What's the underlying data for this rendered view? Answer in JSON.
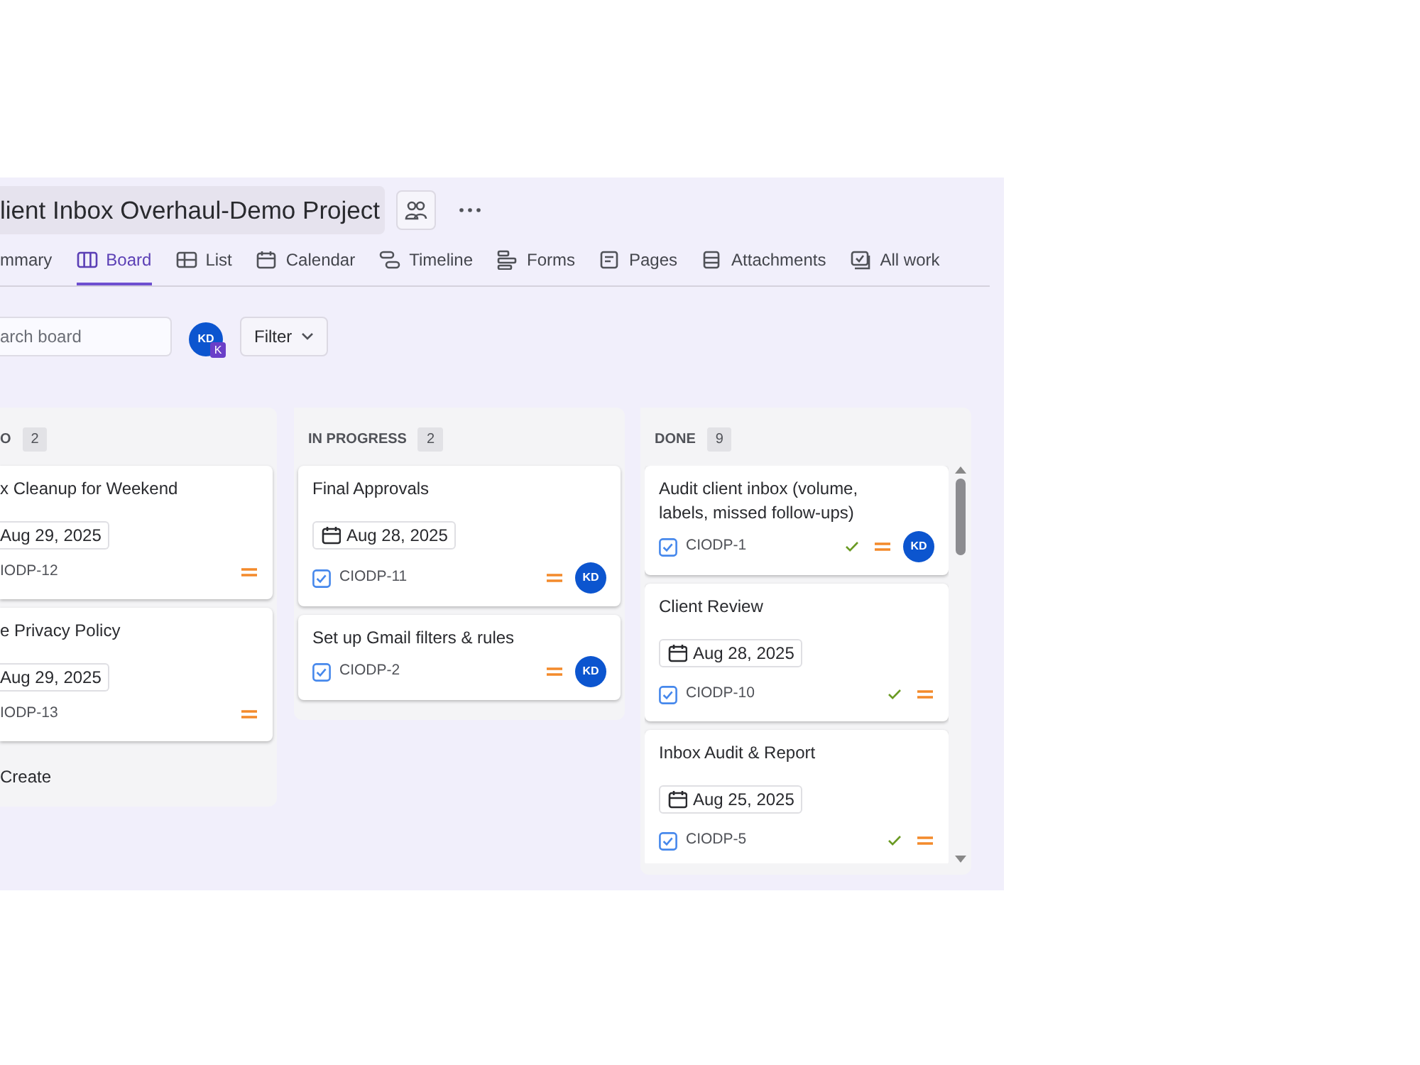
{
  "project": {
    "title": "lient Inbox Overhaul-Demo Project"
  },
  "tabs": [
    {
      "label": "mmary",
      "selected": false
    },
    {
      "label": "Board",
      "selected": true
    },
    {
      "label": "List",
      "selected": false
    },
    {
      "label": "Calendar",
      "selected": false
    },
    {
      "label": "Timeline",
      "selected": false
    },
    {
      "label": "Forms",
      "selected": false
    },
    {
      "label": "Pages",
      "selected": false
    },
    {
      "label": "Attachments",
      "selected": false
    },
    {
      "label": "All work",
      "selected": false
    }
  ],
  "search": {
    "placeholder": "arch board"
  },
  "user_avatar": {
    "initials": "KD",
    "badge": "K"
  },
  "filter_button": {
    "label": "Filter"
  },
  "columns": [
    {
      "title": "O",
      "count": "2",
      "clipped_left": true,
      "create_label": "Create",
      "scrollable": false,
      "cards": [
        {
          "title": "x Cleanup for Weekend",
          "date": "Aug 29, 2025",
          "key": "IODP-12",
          "resolved": false
        },
        {
          "title": "e Privacy Policy",
          "date": "Aug 29, 2025",
          "key": "IODP-13",
          "resolved": false
        }
      ]
    },
    {
      "title": "IN PROGRESS",
      "count": "2",
      "clipped_left": false,
      "scrollable": false,
      "cards": [
        {
          "title": "Final Approvals",
          "date": "Aug 28, 2025",
          "key": "CIODP-11",
          "resolved": false,
          "assignee": "KD"
        },
        {
          "title": "Set up Gmail filters & rules",
          "key": "CIODP-2",
          "resolved": false,
          "assignee": "KD"
        }
      ]
    },
    {
      "title": "DONE",
      "count": "9",
      "clipped_left": false,
      "scrollable": true,
      "cards": [
        {
          "title": "Audit client inbox (volume, labels, missed follow-ups)",
          "key": "CIODP-1",
          "resolved": true,
          "assignee": "KD"
        },
        {
          "title": "Client Review",
          "date": "Aug 28, 2025",
          "key": "CIODP-10",
          "resolved": true
        },
        {
          "title": "Inbox Audit & Report",
          "date": "Aug 25, 2025",
          "key": "CIODP-5",
          "resolved": true
        }
      ]
    }
  ]
}
